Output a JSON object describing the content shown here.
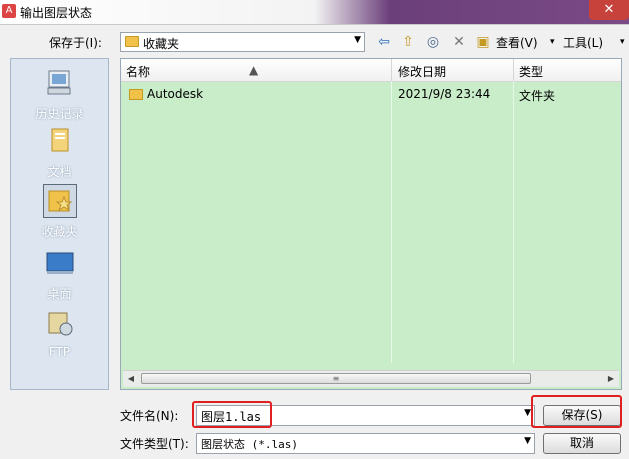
{
  "window": {
    "title": "输出图层状态",
    "close": "✕"
  },
  "toolbar": {
    "save_in_label": "保存于(I):",
    "save_in_value": "收藏夹",
    "views_label": "查看(V)",
    "tools_label": "工具(L)"
  },
  "places": [
    {
      "label": "历史记录"
    },
    {
      "label": "文档"
    },
    {
      "label": "收藏夹"
    },
    {
      "label": "桌面"
    },
    {
      "label": "FTP"
    }
  ],
  "file_list": {
    "columns": [
      "名称",
      "修改日期",
      "类型"
    ],
    "rows": [
      {
        "name": "Autodesk",
        "modified": "2021/9/8 23:44",
        "type": "文件夹"
      }
    ]
  },
  "form": {
    "filename_label": "文件名(N):",
    "filename_value": "图层1.las",
    "filetype_label": "文件类型(T):",
    "filetype_value": "图层状态 (*.las)",
    "save_label": "保存(S)",
    "cancel_label": "取消"
  },
  "colors": {
    "highlight": "#e02020",
    "list_background": "#c9ecc9"
  }
}
